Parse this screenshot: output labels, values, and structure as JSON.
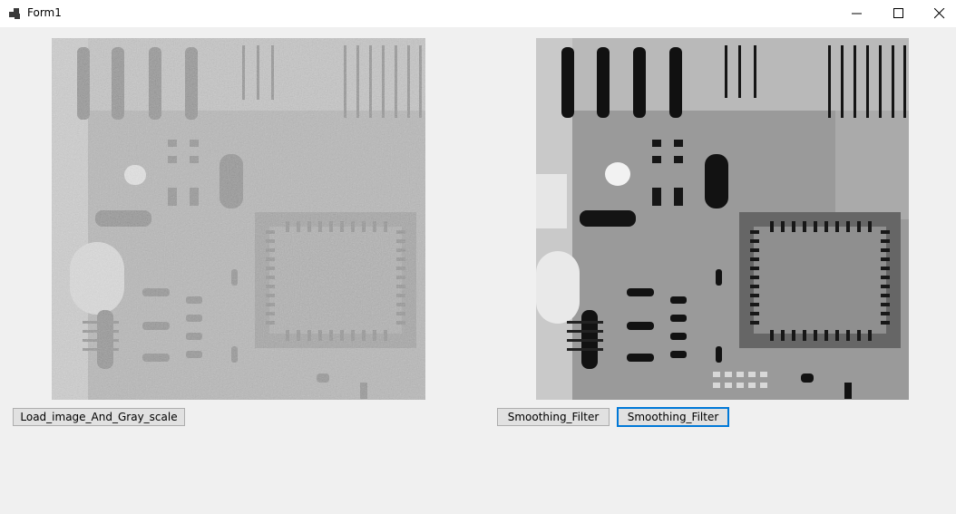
{
  "window": {
    "title": "Form1"
  },
  "icons": {
    "app": "form-app-icon",
    "minimize": "minimize-icon",
    "maximize": "maximize-icon",
    "close": "close-icon"
  },
  "pictures": {
    "original": {
      "content": "noisy grayscale x-ray image of a circuit board"
    },
    "filtered": {
      "content": "smoothed grayscale x-ray image of a circuit board"
    }
  },
  "buttons": {
    "load": "Load_image_And_Gray_scale",
    "smoothing1": "Smoothing_Filter",
    "smoothing2": "Smoothing_Filter"
  },
  "colors": {
    "focus": "#0078d7",
    "button_face": "#e1e1e1",
    "form_background": "#f0f0f0"
  }
}
